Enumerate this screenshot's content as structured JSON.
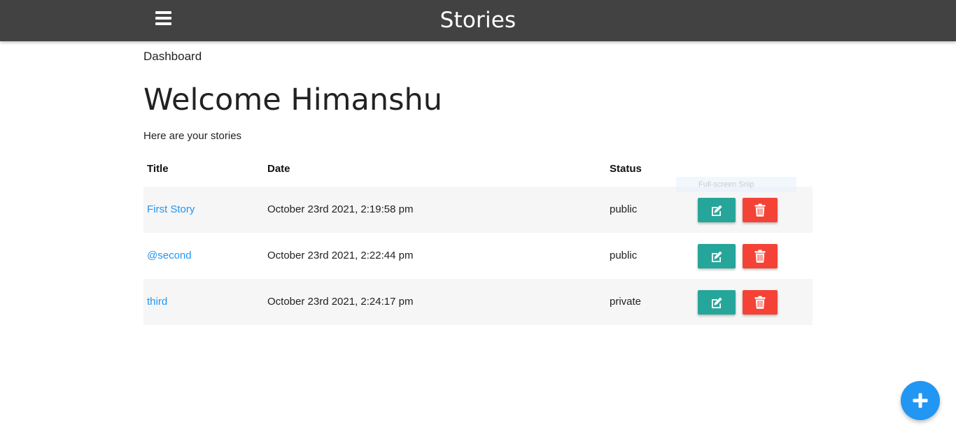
{
  "navbar": {
    "brand": "Stories",
    "menu_icon": "hamburger-menu-icon",
    "background": "#424242"
  },
  "breadcrumb": "Dashboard",
  "heading": "Welcome Himanshu",
  "subtext": "Here are your stories",
  "table": {
    "columns": {
      "title": "Title",
      "date": "Date",
      "status": "Status"
    },
    "rows": [
      {
        "title": "First Story",
        "date": "October 23rd 2021, 2:19:58 pm",
        "status": "public"
      },
      {
        "title": "@second",
        "date": "October 23rd 2021, 2:22:44 pm",
        "status": "public"
      },
      {
        "title": "third",
        "date": "October 23rd 2021, 2:24:17 pm",
        "status": "private"
      }
    ],
    "edit_icon": "edit-icon",
    "delete_icon": "trash-icon"
  },
  "fab_icon": "plus-icon",
  "snip_tooltip": "Full-screen Snip",
  "colors": {
    "link": "#2196f3",
    "edit": "#26a69a",
    "delete": "#f44336",
    "fab": "#2196f3",
    "row_stripe": "#f6f6f6"
  }
}
